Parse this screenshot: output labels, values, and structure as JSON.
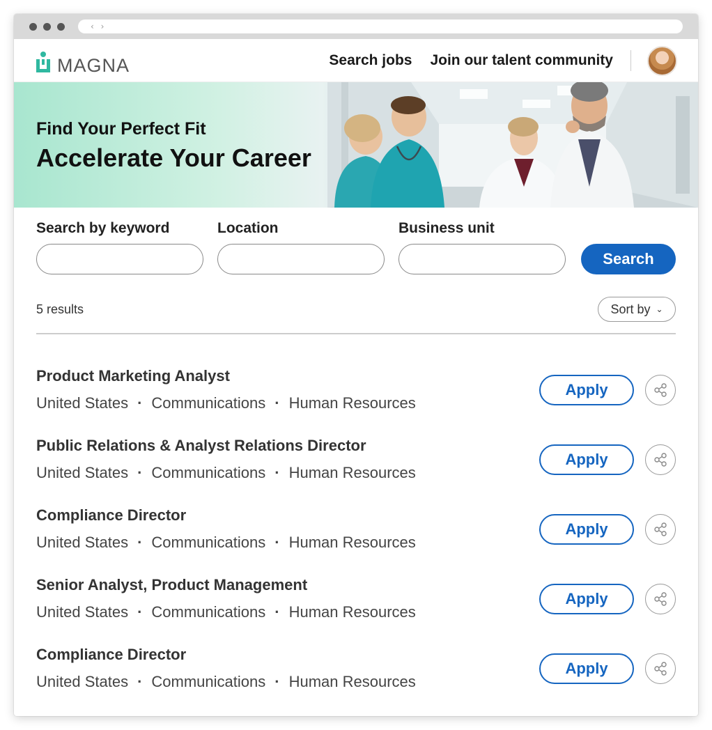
{
  "browser": {
    "nav_arrows": "‹ ›"
  },
  "header": {
    "logo_text": "MAGNA",
    "nav": [
      "Search jobs",
      "Join our talent community"
    ]
  },
  "hero": {
    "subtitle": "Find Your Perfect Fit",
    "title": "Accelerate Your Career"
  },
  "search": {
    "keyword_label": "Search by keyword",
    "keyword_value": "",
    "location_label": "Location",
    "location_value": "",
    "business_unit_label": "Business unit",
    "business_unit_value": "",
    "button_label": "Search"
  },
  "results": {
    "count_label": "5 results",
    "sort_label": "Sort by"
  },
  "jobs": [
    {
      "title": "Product Marketing Analyst",
      "location": "United States",
      "category": "Communications",
      "department": "Human Resources",
      "apply_label": "Apply"
    },
    {
      "title": "Public Relations & Analyst Relations Director",
      "location": "United States",
      "category": "Communications",
      "department": "Human Resources",
      "apply_label": "Apply"
    },
    {
      "title": "Compliance Director",
      "location": "United States",
      "category": "Communications",
      "department": "Human Resources",
      "apply_label": "Apply"
    },
    {
      "title": "Senior Analyst, Product Management",
      "location": "United States",
      "category": "Communications",
      "department": "Human Resources",
      "apply_label": "Apply"
    },
    {
      "title": "Compliance Director",
      "location": "United States",
      "category": "Communications",
      "department": "Human Resources",
      "apply_label": "Apply"
    }
  ],
  "meta_separator": "·",
  "colors": {
    "brand": "#2fb8a0",
    "primary": "#1565c0",
    "text": "#222222"
  },
  "icons": {
    "logo": "magna-person-icon",
    "share": "share-icon",
    "sort": "chevron-down-icon"
  }
}
